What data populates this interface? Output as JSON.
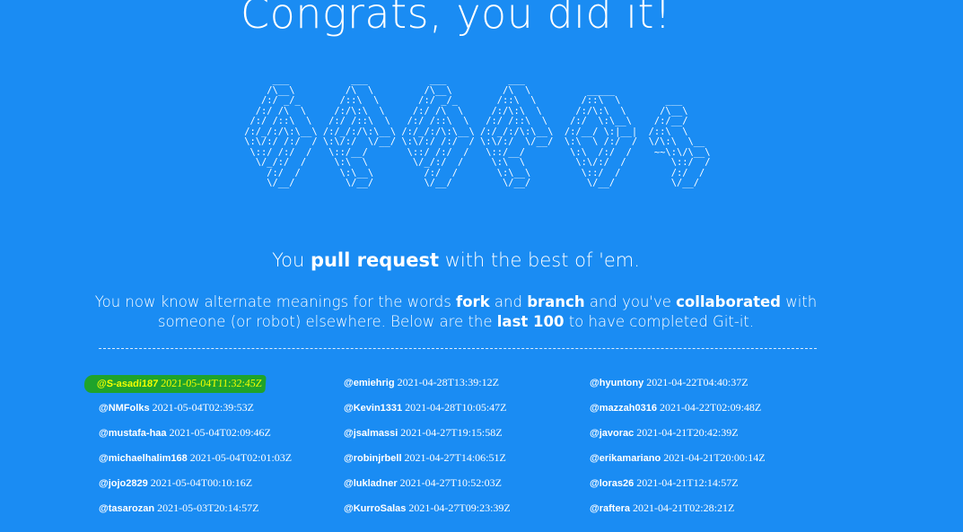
{
  "heading": "Congrats, you did it!",
  "ascii_art": "      ___           ___           ___           ___\n     /\\__\\         /\\  \\         /\\__\\         /\\  \\          _____\n    /:/ _/_       /::\\  \\       /:/ _/_       /::\\  \\        /::\\  \\        ___\n   /:/ /\\  \\     /:/\\:\\  \\     /:/ /\\  \\     /:/\\:\\  \\      /:/\\:\\  \\      /\\__\\\n  /:/ /::\\  \\   /:/ /::\\  \\   /:/ /::\\  \\   /:/ /::\\  \\    /:/  \\:\\__\\    /:/__/\n /:/_/:/\\:\\__\\ /:/_/:/\\:\\__\\ /:/_/:/\\:\\__\\ /:/_/:/\\:\\__\\  /:/__/ \\:|__|  /::\\  \\\n \\:\\/:/ /:/  / \\:\\/:/  \\/__/ \\:\\/:/ /:/  / \\:\\/:/  \\/__/  \\:\\  \\ /:/  /  \\/\\:\\  \\__\n  \\::/ /:/  /   \\::/__/       \\::/ /:/  /   \\::/__/        \\:\\  /:/  /    ~~\\:\\/\\__\\\n   \\/_/:/  /     \\:\\  \\        \\/_/:/  /     \\:\\  \\         \\:\\/:/  /        \\::/  /\n     /:/  /       \\:\\__\\         /:/  /       \\:\\__\\         \\::/  /         /:/  /\n     \\/__/         \\/__/         \\/__/         \\/__/          \\/__/          \\/__/",
  "tagline": {
    "before": "You ",
    "bold": "pull request",
    "after": " with the best of 'em."
  },
  "description": {
    "p1": "You now know alternate meanings for the words ",
    "b1": "fork",
    "p2": " and ",
    "b2": "branch",
    "p3": " and you've ",
    "b3": "collaborated",
    "p4": " with someone (or robot) elsewhere. Below are the ",
    "b4": "last 100",
    "p5": " to have completed Git-it."
  },
  "highlight_color": "#1fa32b",
  "highlight_text_color": "#f2ff00",
  "background_color": "#1a8cf3",
  "columns": [
    [
      {
        "user": "@S-asadi187",
        "time": "2021-05-04T11:32:45Z"
      },
      {
        "user": "@NMFolks",
        "time": "2021-05-04T02:39:53Z"
      },
      {
        "user": "@mustafa-haa",
        "time": "2021-05-04T02:09:46Z"
      },
      {
        "user": "@michaelhalim168",
        "time": "2021-05-04T02:01:03Z"
      },
      {
        "user": "@jojo2829",
        "time": "2021-05-04T00:10:16Z"
      },
      {
        "user": "@tasarozan",
        "time": "2021-05-03T20:14:57Z"
      }
    ],
    [
      {
        "user": "@emiehrig",
        "time": "2021-04-28T13:39:12Z"
      },
      {
        "user": "@Kevin1331",
        "time": "2021-04-28T10:05:47Z"
      },
      {
        "user": "@jsalmassi",
        "time": "2021-04-27T19:15:58Z"
      },
      {
        "user": "@robinjrbell",
        "time": "2021-04-27T14:06:51Z"
      },
      {
        "user": "@lukladner",
        "time": "2021-04-27T10:52:03Z"
      },
      {
        "user": "@KurroSalas",
        "time": "2021-04-27T09:23:39Z"
      }
    ],
    [
      {
        "user": "@hyuntony",
        "time": "2021-04-22T04:40:37Z"
      },
      {
        "user": "@mazzah0316",
        "time": "2021-04-22T02:09:48Z"
      },
      {
        "user": "@javorac",
        "time": "2021-04-21T20:42:39Z"
      },
      {
        "user": "@erikamariano",
        "time": "2021-04-21T20:00:14Z"
      },
      {
        "user": "@loras26",
        "time": "2021-04-21T12:14:57Z"
      },
      {
        "user": "@raftera",
        "time": "2021-04-21T02:28:21Z"
      }
    ]
  ]
}
